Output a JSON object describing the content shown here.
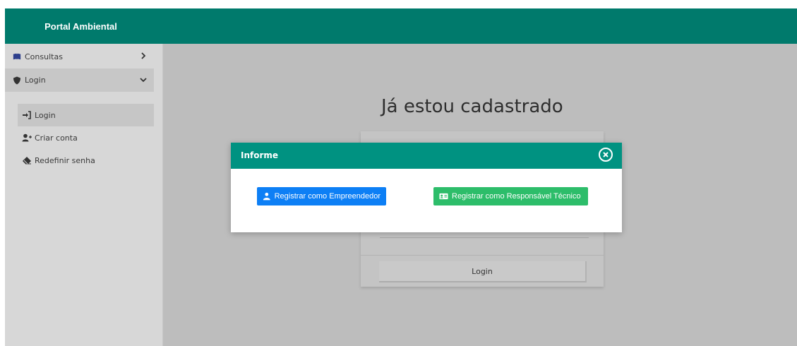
{
  "app": {
    "title": "Portal Ambiental"
  },
  "sidebar": {
    "items": [
      {
        "label": "Consultas",
        "icon": "book-icon"
      },
      {
        "label": "Login",
        "icon": "shield-icon"
      }
    ],
    "subitems": [
      {
        "label": "Login",
        "icon": "sign-in-icon"
      },
      {
        "label": "Criar conta",
        "icon": "user-plus-icon"
      },
      {
        "label": "Redefinir senha",
        "icon": "eraser-icon"
      }
    ]
  },
  "main": {
    "title": "Já estou cadastrado",
    "login_button": "Login"
  },
  "modal": {
    "title": "Informe",
    "buttons": [
      {
        "label": "Registrar como Empreendedor",
        "icon": "user-icon",
        "color": "#0d7ff5"
      },
      {
        "label": "Registrar como Responsável Técnico",
        "icon": "id-card-icon",
        "color": "#2dbd6a"
      }
    ]
  },
  "colors": {
    "header": "#007a6c",
    "modal_header": "#009281",
    "sidebar": "#d7d7d7",
    "overlay": "#bdbdbd"
  }
}
